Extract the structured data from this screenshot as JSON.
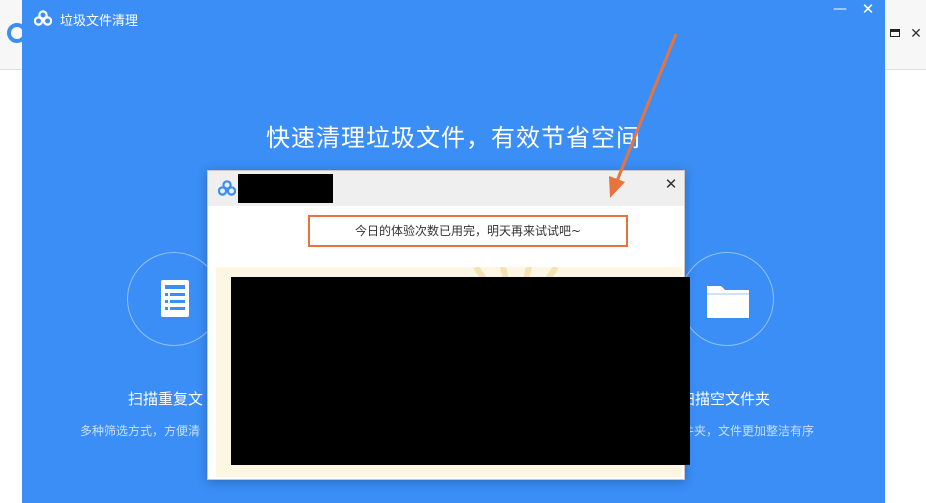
{
  "background_app": {
    "max_glyph": "",
    "close_glyph": "✕"
  },
  "window": {
    "title": "垃圾文件清理",
    "minimize_glyph": "—",
    "close_glyph": "✕"
  },
  "headline": "快速清理垃圾文件，有效节省空间",
  "features": [
    {
      "icon": "list-document-icon",
      "title": "扫描重复文",
      "description": "多种筛选方式，方便清"
    },
    {
      "icon": "folder-icon",
      "title": "扫描空文件夹",
      "description": "件夹，文件更加整洁有序"
    }
  ],
  "dialog": {
    "close_glyph": "✕",
    "message": "今日的体验次数已用完，明天再来试试吧~"
  },
  "colors": {
    "primary_blue": "#3a8ef6",
    "highlight_orange": "#e8743b",
    "banner_cream": "#fdf6e3"
  }
}
